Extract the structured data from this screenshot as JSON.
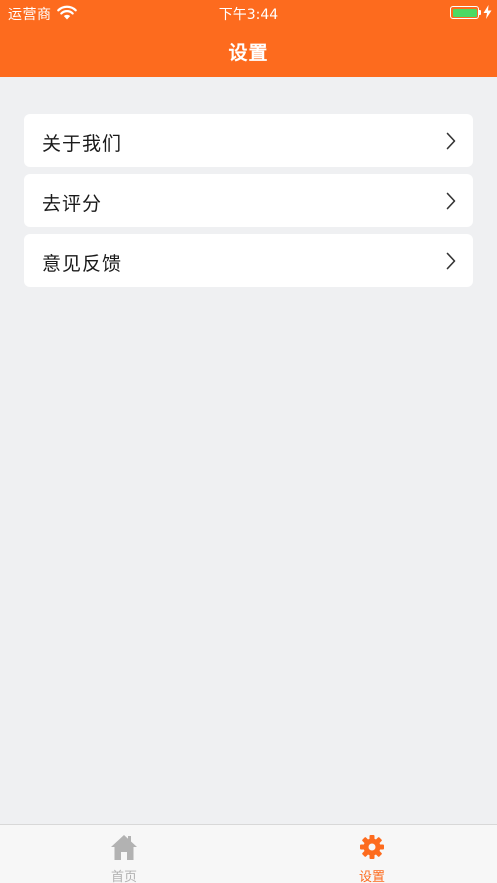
{
  "status_bar": {
    "carrier": "运营商",
    "time": "下午3:44",
    "battery_color": "#4cd964"
  },
  "nav": {
    "title": "设置",
    "background": "#fd6b1e"
  },
  "menu": {
    "items": [
      {
        "label": "关于我们",
        "icon": "chevron-right-icon"
      },
      {
        "label": "去评分",
        "icon": "chevron-right-icon"
      },
      {
        "label": "意见反馈",
        "icon": "chevron-right-icon"
      }
    ]
  },
  "tabbar": {
    "tabs": [
      {
        "label": "首页",
        "icon": "home-icon",
        "active": false,
        "color": "#b2b2b2"
      },
      {
        "label": "设置",
        "icon": "gear-icon",
        "active": true,
        "color": "#fd6b1e"
      }
    ]
  }
}
